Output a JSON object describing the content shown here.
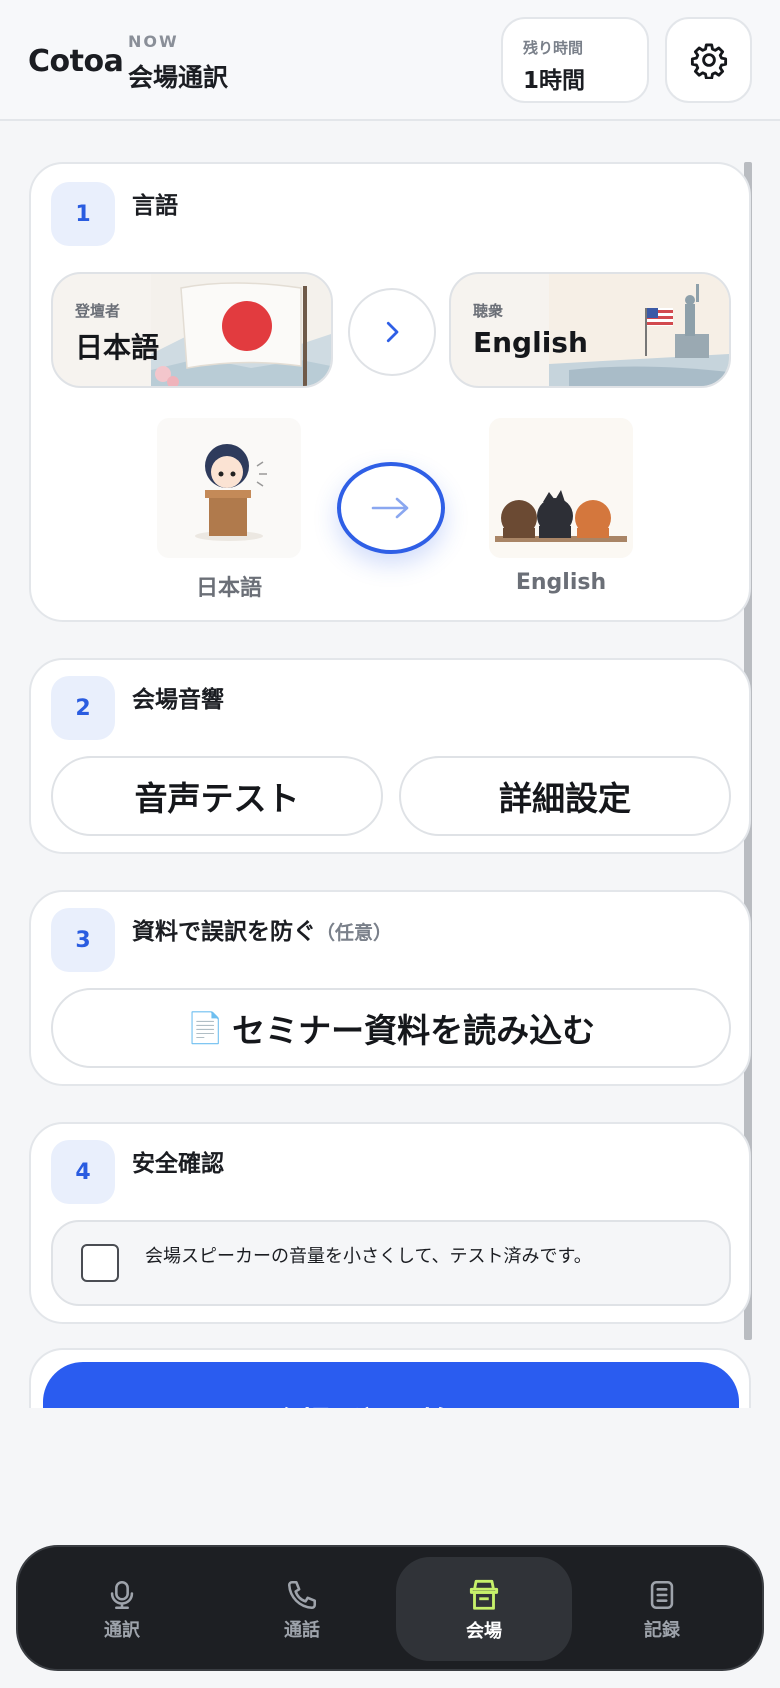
{
  "header": {
    "brand": "Cotoa",
    "mode_label": "NOW",
    "mode_value": "会場通訳",
    "remaining_label": "残り時間",
    "remaining_value": "1時間"
  },
  "steps": {
    "s1": {
      "number": "1",
      "title": "言語",
      "speaker_role": "登壇者",
      "speaker_lang": "日本語",
      "audience_role": "聴衆",
      "audience_lang": "English",
      "speaker_caption": "日本語",
      "audience_caption": "English"
    },
    "s2": {
      "number": "2",
      "title": "会場音響",
      "audio_test_label": "音声テスト",
      "advanced_label": "詳細設定"
    },
    "s3": {
      "number": "3",
      "title": "資料で誤訳を防ぐ",
      "optional": "（任意）",
      "load_icon": "📄",
      "load_label": "セミナー資料を読み込む"
    },
    "s4": {
      "number": "4",
      "title": "安全確認",
      "check_label": "会場スピーカーの音量を小さくして、テスト済みです。"
    }
  },
  "start": {
    "label": "会場通訳を始める"
  },
  "nav": {
    "items": [
      {
        "label": "通訳",
        "icon": "mic-icon"
      },
      {
        "label": "通話",
        "icon": "phone-icon"
      },
      {
        "label": "会場",
        "icon": "podium-icon"
      },
      {
        "label": "記録",
        "icon": "notes-icon"
      }
    ],
    "active": "会場"
  },
  "colors": {
    "accent": "#2a5cf0",
    "active_nav_icon": "#c6f06a"
  }
}
